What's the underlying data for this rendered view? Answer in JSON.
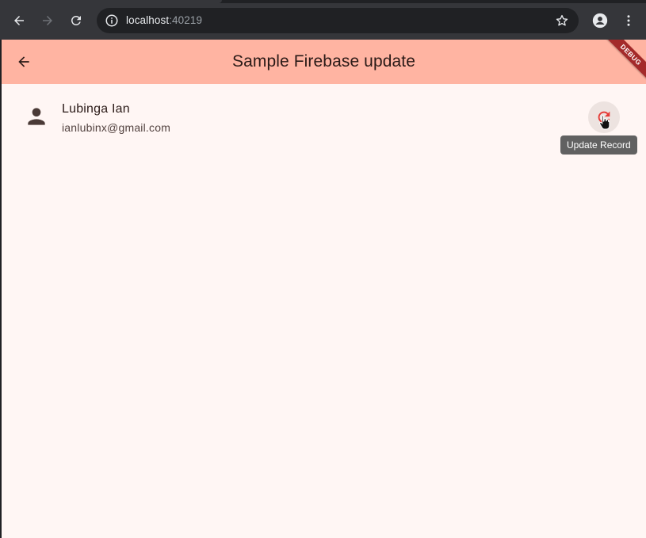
{
  "browser": {
    "url_host": "localhost",
    "url_port": ":40219",
    "icons": {
      "back": "arrow-left-icon",
      "forward": "arrow-right-icon",
      "reload": "reload-icon",
      "info": "info-icon",
      "bookmark": "star-icon",
      "profile": "profile-icon",
      "menu": "kebab-menu-icon"
    }
  },
  "app": {
    "title": "Sample Firebase update",
    "debug_banner": "DEBUG",
    "colors": {
      "appbar": "#ffb4a2",
      "background": "#fff6f4",
      "accent": "#e53935",
      "debug": "#a42a2a"
    },
    "record": {
      "name": "Lubinga Ian",
      "email": "ianlubinx@gmail.com"
    },
    "update_tooltip": "Update Record"
  }
}
